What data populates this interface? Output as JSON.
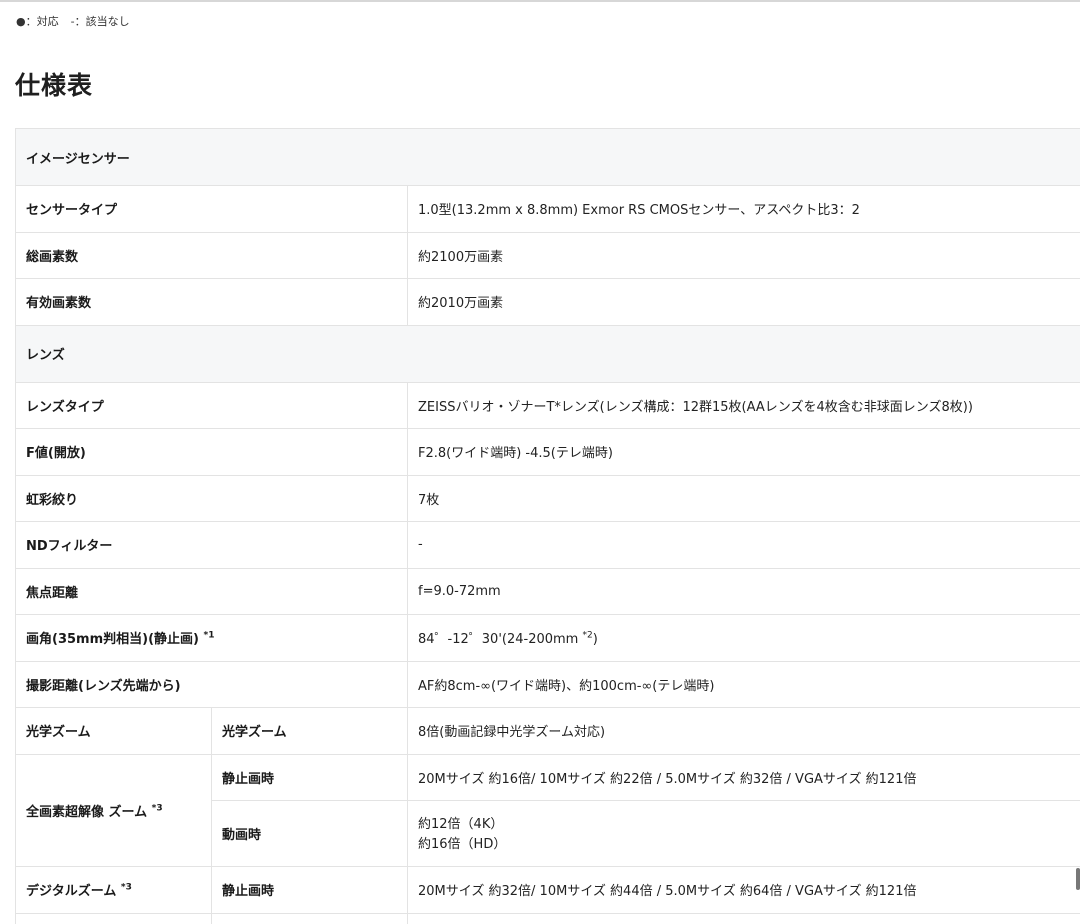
{
  "legend": {
    "supported": "●：対応",
    "not_applicable": "-：該当なし"
  },
  "page_title": "仕様表",
  "sections": {
    "sensor": "イメージセンサー",
    "lens": "レンズ"
  },
  "rows": {
    "sensor_type": {
      "label": "センサータイプ",
      "value": "1.0型(13.2mm x 8.8mm) Exmor RS CMOSセンサー、アスペクト比3：2"
    },
    "total_pixels": {
      "label": "総画素数",
      "value": "約2100万画素"
    },
    "effective_pixels": {
      "label": "有効画素数",
      "value": "約2010万画素"
    },
    "lens_type": {
      "label": "レンズタイプ",
      "value": "ZEISSバリオ・ゾナーT*レンズ(レンズ構成：12群15枚(AAレンズを4枚含む非球面レンズ8枚))"
    },
    "f_number": {
      "label": "F値(開放)",
      "value": "F2.8(ワイド端時) -4.5(テレ端時)"
    },
    "aperture_blades": {
      "label": "虹彩絞り",
      "value": "7枚"
    },
    "nd_filter": {
      "label": "NDフィルター",
      "value": "-"
    },
    "focal_length": {
      "label": "焦点距離",
      "value": "f=9.0-72mm"
    },
    "angle_of_view": {
      "label": "画角(35mm判相当)(静止画)",
      "label_note": "*1",
      "value_pre": "84゜-12゜30'(24-200mm ",
      "value_note": "*2",
      "value_post": ")"
    },
    "shooting_distance": {
      "label": "撮影距離(レンズ先端から)",
      "value": "AF約8cm-∞(ワイド端時)、約100cm-∞(テレ端時)"
    },
    "optical_zoom": {
      "label": "光学ズーム",
      "sub_label": "光学ズーム",
      "value": "8倍(動画記録中光学ズーム対応)"
    },
    "clear_image_zoom": {
      "label": "全画素超解像 ズーム",
      "label_note": "*3",
      "still_label": "静止画時",
      "still_value": "20Mサイズ 約16倍/ 10Mサイズ 約22倍 / 5.0Mサイズ 約32倍 / VGAサイズ 約121倍",
      "movie_label": "動画時",
      "movie_value_1": "約12倍（4K）",
      "movie_value_2": "約16倍（HD）"
    },
    "digital_zoom": {
      "label": "デジタルズーム",
      "label_note": "*3",
      "still_label": "静止画時",
      "still_value": "20Mサイズ 約32倍/ 10Mサイズ 約44倍 / 5.0Mサイズ 約64倍 / VGAサイズ 約121倍"
    }
  }
}
